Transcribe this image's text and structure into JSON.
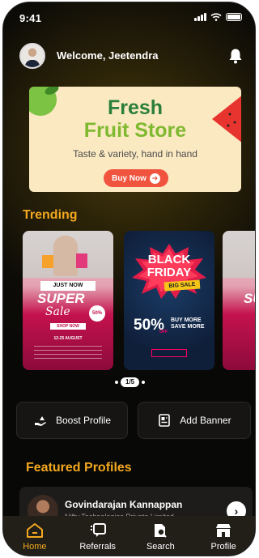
{
  "status_bar": {
    "time": "9:41"
  },
  "header": {
    "welcome": "Welcome, Jeetendra",
    "avatar_icon": "user-avatar",
    "bell_icon": "bell-icon"
  },
  "banner": {
    "title_line1": "Fresh",
    "title_line2": "Fruit Store",
    "tagline": "Taste & variety, hand in hand",
    "button_label": "Buy Now",
    "colors": {
      "background": "#fbe9c2",
      "title1": "#2a7f3a",
      "title2": "#7fb92f",
      "button": "#f0533e"
    }
  },
  "trending": {
    "title": "Trending",
    "pager": "1/5",
    "cards": [
      {
        "tag": "JUST NOW",
        "headline": "SUPER",
        "script": "Sale",
        "badge": "50%",
        "button": "SHOP NOW",
        "date": "12-25 AUGUST"
      },
      {
        "line1": "BLACK",
        "line2": "FRIDAY",
        "tag": "BIG SALE",
        "percent": "50%",
        "off": "OFF",
        "promo_line1": "BUY MORE",
        "promo_line2": "SAVE MORE"
      },
      {
        "headline": "SUP"
      }
    ]
  },
  "actions": {
    "boost_label": "Boost Profile",
    "add_banner_label": "Add Banner"
  },
  "featured": {
    "title": "Featured Profiles",
    "profile": {
      "name": "Govindarajan Kannappan",
      "company": "Nifty Technologies Private Limited"
    }
  },
  "nav": {
    "items": [
      {
        "label": "Home",
        "icon": "home-icon",
        "active": true
      },
      {
        "label": "Referrals",
        "icon": "referrals-icon"
      },
      {
        "label": "Search",
        "icon": "search-icon"
      },
      {
        "label": "Profile",
        "icon": "store-icon"
      }
    ]
  },
  "colors": {
    "accent": "#f3a81f",
    "nav_background": "#221f19",
    "card_background": "#161514"
  }
}
